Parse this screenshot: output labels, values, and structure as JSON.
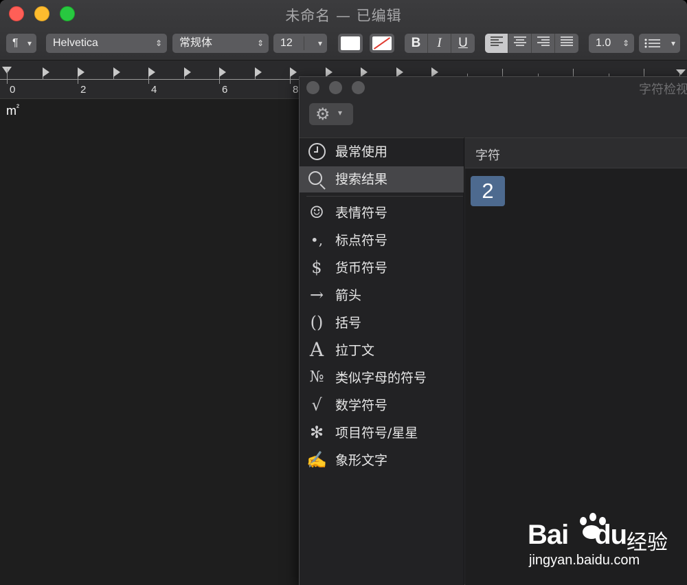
{
  "window": {
    "title": "未命名 — 已编辑"
  },
  "toolbar": {
    "paragraph_style": "¶",
    "font_family": "Helvetica",
    "font_style": "常规体",
    "font_size": "12",
    "bold": "B",
    "italic": "I",
    "underline": "U",
    "line_spacing": "1.0",
    "list_icon": "list-icon",
    "text_color": "#ffffff",
    "highlight_color": "none"
  },
  "ruler": {
    "numbers": [
      "0",
      "2",
      "4",
      "6",
      "8"
    ]
  },
  "document": {
    "text_base": "m",
    "text_sup": "²"
  },
  "character_viewer": {
    "title": "字符检视器",
    "gear_icon": "gear-icon",
    "sidebar": {
      "items": [
        {
          "label": "最常使用",
          "icon": "clock-icon"
        },
        {
          "label": "搜索结果",
          "icon": "search-icon",
          "selected": true
        },
        {
          "label": "表情符号",
          "icon": "☺"
        },
        {
          "label": "标点符号",
          "icon": "•,"
        },
        {
          "label": "货币符号",
          "icon": "$"
        },
        {
          "label": "箭头",
          "icon": "→"
        },
        {
          "label": "括号",
          "icon": "()"
        },
        {
          "label": "拉丁文",
          "icon": "A"
        },
        {
          "label": "类似字母的符号",
          "icon": "№"
        },
        {
          "label": "数学符号",
          "icon": "√"
        },
        {
          "label": "项目符号/星星",
          "icon": "✻"
        },
        {
          "label": "象形文字",
          "icon": "✍"
        }
      ]
    },
    "content": {
      "header": "字符",
      "characters": [
        "2"
      ]
    },
    "accent": "#4d6a8f"
  },
  "watermark": {
    "brand_a": "Bai",
    "brand_b": "du",
    "brand_cn": "经验",
    "url": "jingyan.baidu.com"
  }
}
